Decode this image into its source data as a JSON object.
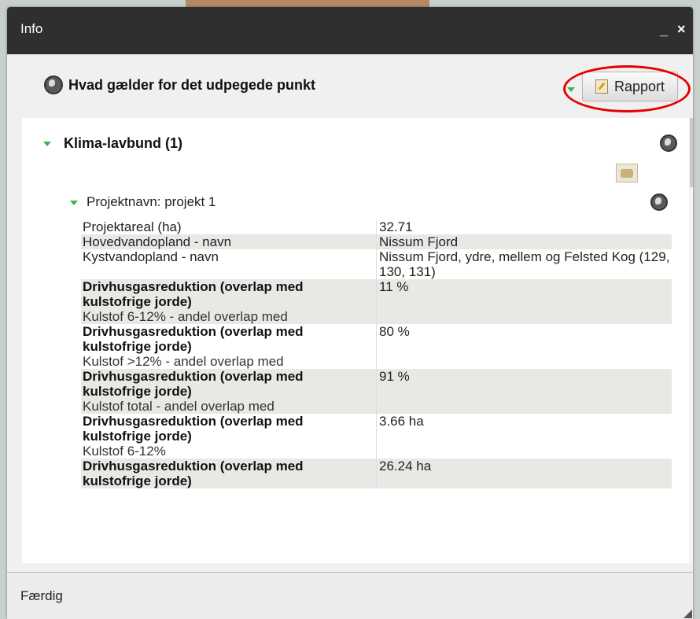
{
  "window": {
    "title": "Info",
    "minimize": "_",
    "close": "×"
  },
  "header": {
    "text": "Hvad gælder for det udpegede punkt",
    "report_button": "Rapport"
  },
  "section": {
    "title": "Klima-lavbund (1)",
    "project_title": "Projektnavn: projekt 1",
    "rows": [
      {
        "label": "Projektareal (ha)",
        "value": "32.71"
      },
      {
        "label": "Hovedvandopland - navn",
        "value": "Nissum Fjord"
      },
      {
        "label": "Kystvandopland - navn",
        "value": "Nissum Fjord, ydre, mellem og Felsted Kog (129, 130, 131)"
      },
      {
        "bold1": "Drivhusgasreduktion (overlap med",
        "bold2": "kulstofrige jorde)",
        "sub": "Kulstof 6-12% - andel overlap med",
        "value": "11 %"
      },
      {
        "bold1": "Drivhusgasreduktion (overlap med",
        "bold2": "kulstofrige jorde)",
        "sub": "Kulstof >12% - andel overlap med",
        "value": "80 %"
      },
      {
        "bold1": "Drivhusgasreduktion (overlap med",
        "bold2": "kulstofrige jorde)",
        "sub": "Kulstof total - andel overlap med",
        "value": "91 %"
      },
      {
        "bold1": "Drivhusgasreduktion (overlap med",
        "bold2": "kulstofrige jorde)",
        "sub": "Kulstof 6-12%",
        "value": "3.66 ha"
      },
      {
        "bold1": "Drivhusgasreduktion (overlap med",
        "bold2": "kulstofrige jorde)",
        "value": "26.24 ha"
      }
    ]
  },
  "footer": {
    "done": "Færdig"
  },
  "colors": {
    "accent_green": "#3cb44a",
    "highlight_red": "#e40000",
    "titlebar": "#2f2f2f"
  },
  "icons": [
    "globe-icon",
    "report-icon",
    "map-figure-icon",
    "chevron-down-icon"
  ]
}
